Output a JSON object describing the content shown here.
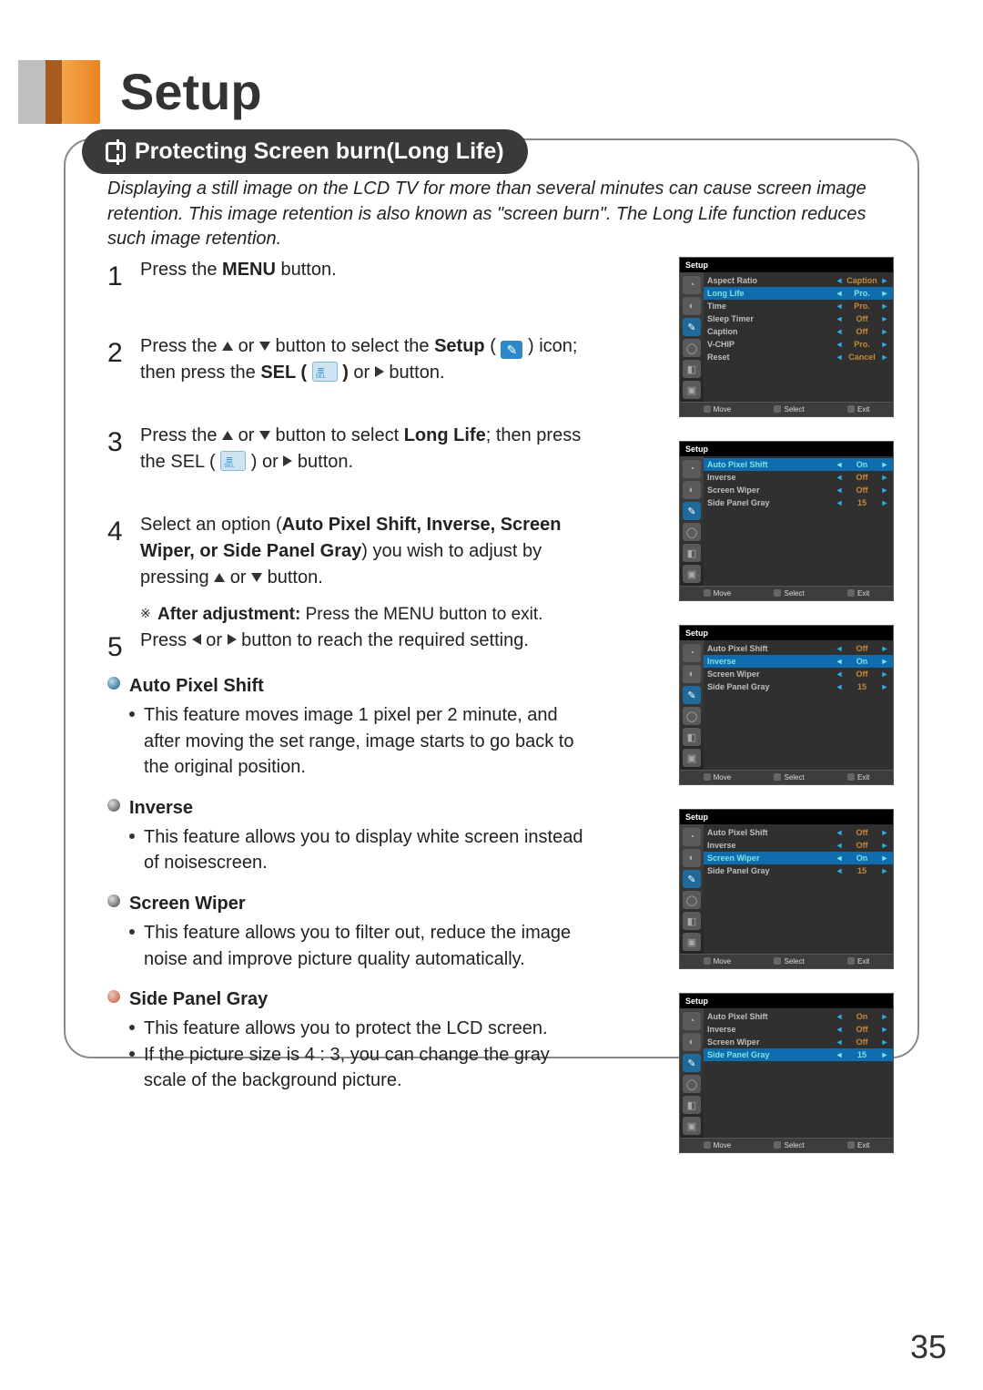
{
  "page_number": "35",
  "section_title": "Setup",
  "pill_heading": "Protecting Screen burn(Long Life)",
  "intro": "Displaying a still image on the LCD TV for more than several minutes can cause screen image retention. This image retention is also known as \"screen burn\". The Long Life function reduces such image retention.",
  "steps": [
    {
      "num": "1",
      "html": "Press the <b>MENU</b> button."
    },
    {
      "num": "2",
      "html": "Press the <span class='tri u'></span> or <span class='tri d'></span> button to select the <b>Setup</b> ( <span class='icon-setup' data-name='setup-icon' data-interactable='false'></span> ) icon; then press the <b>SEL (</b> <span class='icon-sel' data-name='sel-icon' data-interactable='false'></span> <b>)</b> or <span class='tri r'></span> button."
    },
    {
      "num": "3",
      "html": "Press the <span class='tri u'></span> or <span class='tri d'></span> button to select <b>Long Life</b>; then press the SEL ( <span class='icon-sel' data-name='sel-icon' data-interactable='false'></span> ) or <span class='tri r'></span> button."
    },
    {
      "num": "4",
      "html": "Select an option (<b>Auto Pixel Shift, Inverse, Screen Wiper, or Side Panel Gray</b>) you wish to adjust by pressing <span class='tri u'></span> or <span class='tri d'></span> button."
    },
    {
      "num": "5",
      "html": "Press <span class='tri l'></span> or <span class='tri r'></span> button to reach the required setting."
    }
  ],
  "after_note_label": "After adjustment:",
  "after_note_text": " Press the MENU button to exit.",
  "features": [
    {
      "h": "Auto Pixel Shift",
      "b": [
        "This feature moves image 1 pixel per 2 minute, and after moving the set range, image starts to go back to the original position."
      ]
    },
    {
      "h": "Inverse",
      "b": [
        "This feature allows you to display white screen instead of noisescreen."
      ]
    },
    {
      "h": "Screen Wiper",
      "b": [
        "This feature allows you to filter out, reduce the image noise and improve picture quality automatically."
      ]
    },
    {
      "h": "Side Panel Gray",
      "b": [
        "This feature allows you to protect the LCD screen.",
        "If the picture size is  4 : 3, you can change the gray scale of the background picture."
      ]
    }
  ],
  "osd": {
    "title": "Setup",
    "footer_select": "Select",
    "footer_exit": "Exit",
    "footer_move": "Move",
    "menus": [
      {
        "rows": [
          {
            "lab": "Aspect Ratio",
            "val": "Caption"
          },
          {
            "lab": "Long Life",
            "val": "Pro.",
            "sel": true
          },
          {
            "lab": "Time",
            "val": "Pro."
          },
          {
            "lab": "Sleep Timer",
            "val": "Off"
          },
          {
            "lab": "Caption",
            "val": "Off"
          },
          {
            "lab": "V-CHIP",
            "val": "Pro."
          },
          {
            "lab": "Reset",
            "val": "Cancel"
          }
        ]
      },
      {
        "rows": [
          {
            "lab": "Auto Pixel Shift",
            "val": "On",
            "sel": true
          },
          {
            "lab": "Inverse",
            "val": "Off"
          },
          {
            "lab": "Screen Wiper",
            "val": "Off"
          },
          {
            "lab": "Side Panel Gray",
            "val": "15"
          }
        ]
      },
      {
        "rows": [
          {
            "lab": "Auto Pixel Shift",
            "val": "Off"
          },
          {
            "lab": "Inverse",
            "val": "On",
            "sel": true
          },
          {
            "lab": "Screen Wiper",
            "val": "Off"
          },
          {
            "lab": "Side Panel Gray",
            "val": "15"
          }
        ]
      },
      {
        "rows": [
          {
            "lab": "Auto Pixel Shift",
            "val": "Off"
          },
          {
            "lab": "Inverse",
            "val": "Off"
          },
          {
            "lab": "Screen Wiper",
            "val": "On",
            "sel": true
          },
          {
            "lab": "Side Panel Gray",
            "val": "15"
          }
        ]
      },
      {
        "rows": [
          {
            "lab": "Auto Pixel Shift",
            "val": "On"
          },
          {
            "lab": "Inverse",
            "val": "Off"
          },
          {
            "lab": "Screen Wiper",
            "val": "Off"
          },
          {
            "lab": "Side Panel Gray",
            "val": "15",
            "sel": true
          }
        ]
      }
    ]
  },
  "icons": [
    "◔",
    "◐",
    "✎",
    "◯",
    "◧",
    "▣"
  ]
}
